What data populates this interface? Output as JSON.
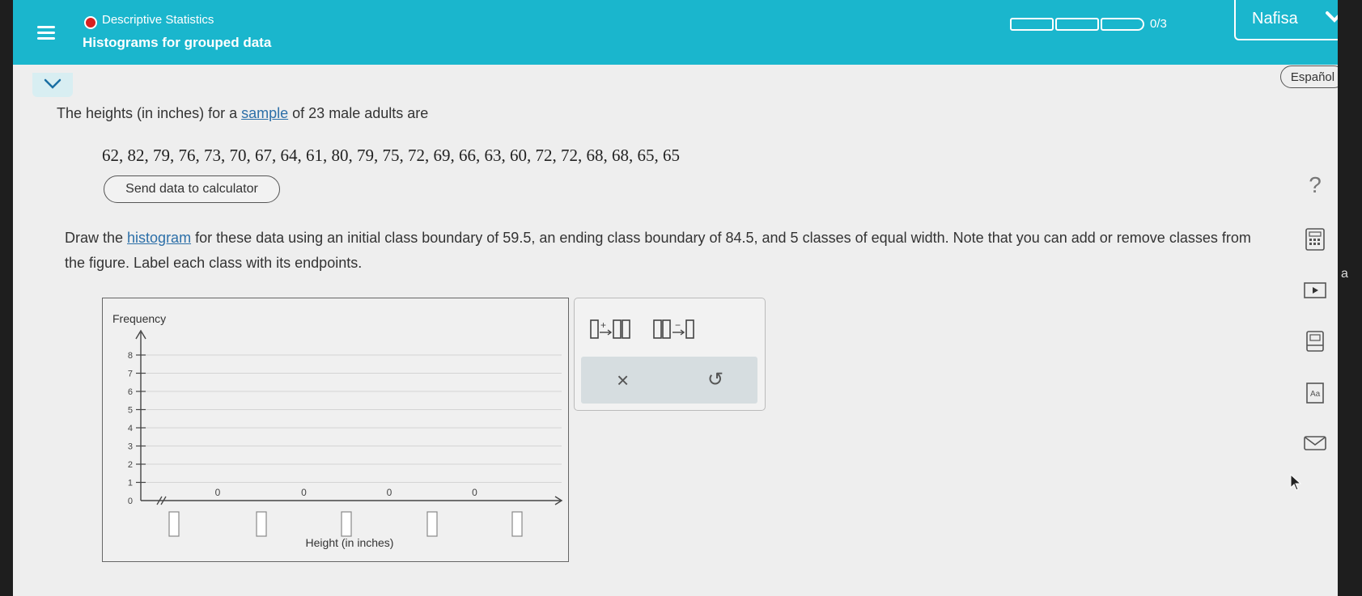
{
  "header": {
    "topic": "Descriptive Statistics",
    "lesson": "Histograms for grouped data",
    "progress_text": "0/3",
    "user_name": "Nafisa"
  },
  "language_button": "Español",
  "question": {
    "intro_prefix": "The heights (in inches) for a ",
    "intro_link": "sample",
    "intro_suffix": " of 23 male adults are",
    "data_values": "62, 82, 79, 76, 73, 70, 67, 64, 61, 80, 79, 75, 72, 69, 66, 63, 60, 72, 72, 68, 68, 65, 65",
    "send_button": "Send data to calculator",
    "instr_prefix": "Draw the ",
    "instr_link": "histogram",
    "instr_suffix": " for these data using an initial class boundary of 59.5, an ending class boundary of 84.5, and 5 classes of equal width. Note that you can add or remove classes from the figure. Label each class with its endpoints."
  },
  "chart_data": {
    "type": "bar",
    "ylabel": "Frequency",
    "xlabel": "Height (in inches)",
    "yticks": [
      "0",
      "1",
      "2",
      "3",
      "4",
      "5",
      "6",
      "7",
      "8"
    ],
    "ylim": [
      0,
      8.5
    ],
    "bar_values": [
      0,
      0,
      0,
      0
    ],
    "bar_value_labels": [
      "0",
      "0",
      "0",
      "0"
    ],
    "endpoint_boxes": [
      "",
      "",
      "",
      "",
      ""
    ]
  },
  "tools": {
    "clear_symbol": "×",
    "undo_symbol": "↺"
  },
  "side_icons": [
    "help-icon",
    "calculator-icon",
    "video-icon",
    "textbook-icon",
    "glossary-icon",
    "message-icon"
  ],
  "help_symbol": "?",
  "edge_text": "a"
}
